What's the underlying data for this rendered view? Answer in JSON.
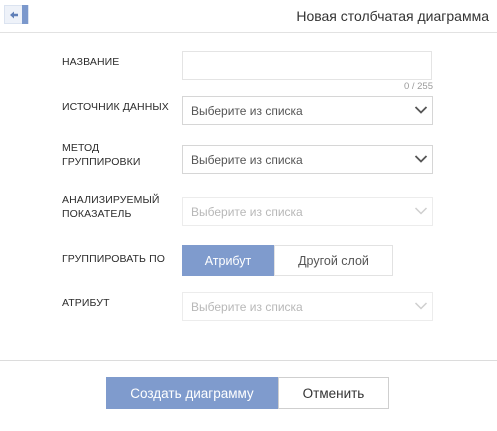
{
  "header": {
    "back_icon": "arrow-left-icon",
    "title": "Новая столбчатая диаграмма"
  },
  "form": {
    "name": {
      "label": "НАЗВАНИЕ",
      "value": "",
      "counter": "0 / 255"
    },
    "data_source": {
      "label": "ИСТОЧНИК ДАННЫХ",
      "placeholder": "Выберите из списка"
    },
    "grouping_method": {
      "label_line1": "МЕТОД",
      "label_line2": "ГРУППИРОВКИ",
      "placeholder": "Выберите из списка"
    },
    "metric": {
      "label_line1": "АНАЛИЗИРУЕМЫЙ",
      "label_line2": "ПОКАЗАТЕЛЬ",
      "placeholder": "Выберите из списка"
    },
    "group_by": {
      "label": "ГРУППИРОВАТЬ ПО",
      "options": [
        "Атрибут",
        "Другой слой"
      ],
      "selected": "Атрибут"
    },
    "attribute": {
      "label": "АТРИБУТ",
      "placeholder": "Выберите из списка"
    }
  },
  "footer": {
    "create_label": "Создать диаграмму",
    "cancel_label": "Отменить"
  },
  "colors": {
    "accent": "#7f9bcd",
    "border": "#d6d6d6"
  }
}
